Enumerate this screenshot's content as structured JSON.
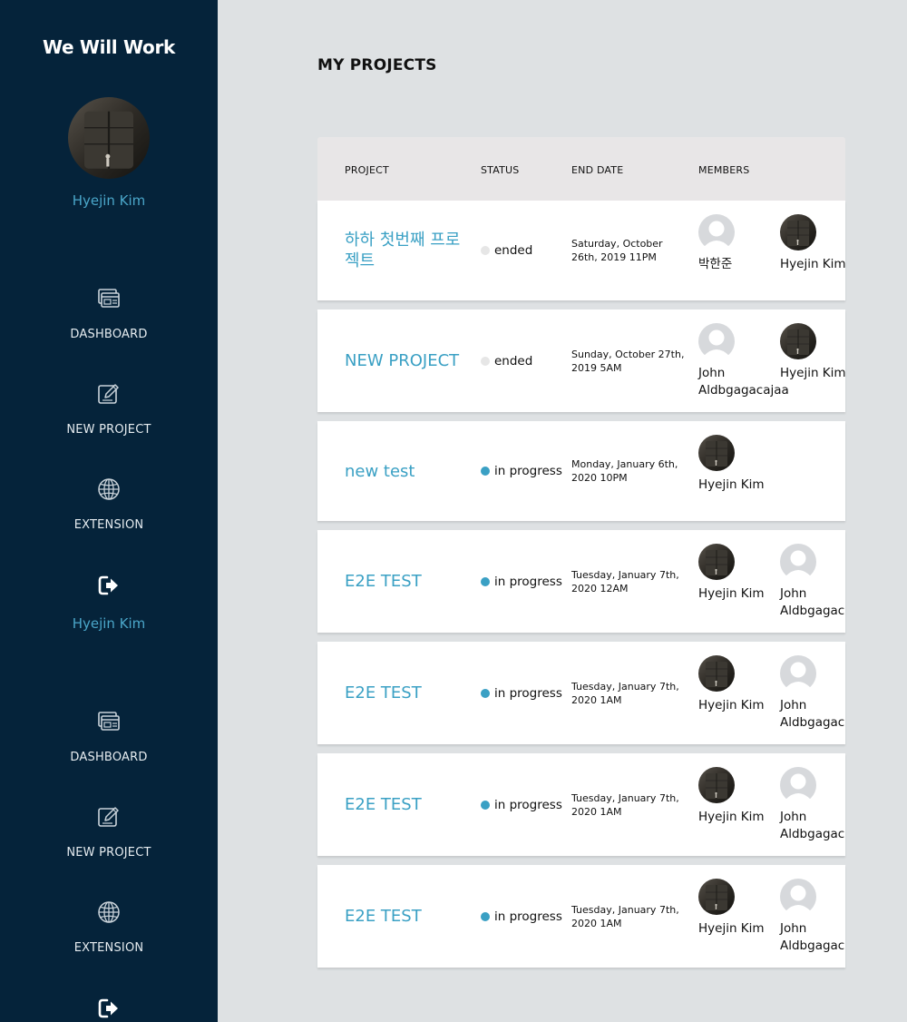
{
  "app": {
    "brand": "We Will Work",
    "username": "Hyejin Kim"
  },
  "sidebar": {
    "items": [
      {
        "label": "DASHBOARD",
        "icon": "dashboard-icon"
      },
      {
        "label": "NEW PROJECT",
        "icon": "edit-icon"
      },
      {
        "label": "EXTENSION",
        "icon": "globe-icon"
      },
      {
        "label": "",
        "icon": "logout-icon"
      }
    ],
    "logout_username": "Hyejin Kim"
  },
  "main": {
    "title": "MY PROJECTS",
    "headers": {
      "project": "PROJECT",
      "status": "STATUS",
      "end_date": "END DATE",
      "members": "MEMBERS"
    }
  },
  "projects": [
    {
      "name": "하하 첫번째 프로젝트",
      "status": "ended",
      "end_date": "Saturday, October 26th, 2019 11PM",
      "members": [
        {
          "name": "박한준",
          "avatar": "default-avatar-icon"
        },
        {
          "name": "Hyejin Kim",
          "avatar": "photo"
        }
      ]
    },
    {
      "name": "NEW PROJECT",
      "status": "ended",
      "end_date": "Sunday, October 27th, 2019 5AM",
      "members": [
        {
          "name": "John Aldbgagacajaa",
          "avatar": "default-avatar-icon"
        },
        {
          "name": "Hyejin Kim",
          "avatar": "photo"
        }
      ]
    },
    {
      "name": "new test",
      "status": "in progress",
      "end_date": "Monday, January 6th, 2020 10PM",
      "members": [
        {
          "name": "Hyejin Kim",
          "avatar": "photo"
        }
      ]
    },
    {
      "name": "E2E TEST",
      "status": "in progress",
      "end_date": "Tuesday, January 7th, 2020 12AM",
      "members": [
        {
          "name": "Hyejin Kim",
          "avatar": "photo"
        },
        {
          "name": "John Aldbgagacajaa",
          "avatar": "default-avatar-icon"
        }
      ]
    },
    {
      "name": "E2E TEST",
      "status": "in progress",
      "end_date": "Tuesday, January 7th, 2020 1AM",
      "members": [
        {
          "name": "Hyejin Kim",
          "avatar": "photo"
        },
        {
          "name": "John Aldbgagacajaa",
          "avatar": "default-avatar-icon"
        }
      ]
    },
    {
      "name": "E2E TEST",
      "status": "in progress",
      "end_date": "Tuesday, January 7th, 2020 1AM",
      "members": [
        {
          "name": "Hyejin Kim",
          "avatar": "photo"
        },
        {
          "name": "John Aldbgagacajaa",
          "avatar": "default-avatar-icon"
        }
      ]
    },
    {
      "name": "E2E TEST",
      "status": "in progress",
      "end_date": "Tuesday, January 7th, 2020 1AM",
      "members": [
        {
          "name": "Hyejin Kim",
          "avatar": "photo"
        },
        {
          "name": "John Aldbgagacajaa",
          "avatar": "default-avatar-icon"
        }
      ]
    }
  ],
  "colors": {
    "sidebar_bg": "#05233a",
    "accent": "#3aa0c4",
    "status_ended": "#e6e6e6",
    "status_in_progress": "#3aa0c4",
    "page_bg": "#dee1e3"
  }
}
